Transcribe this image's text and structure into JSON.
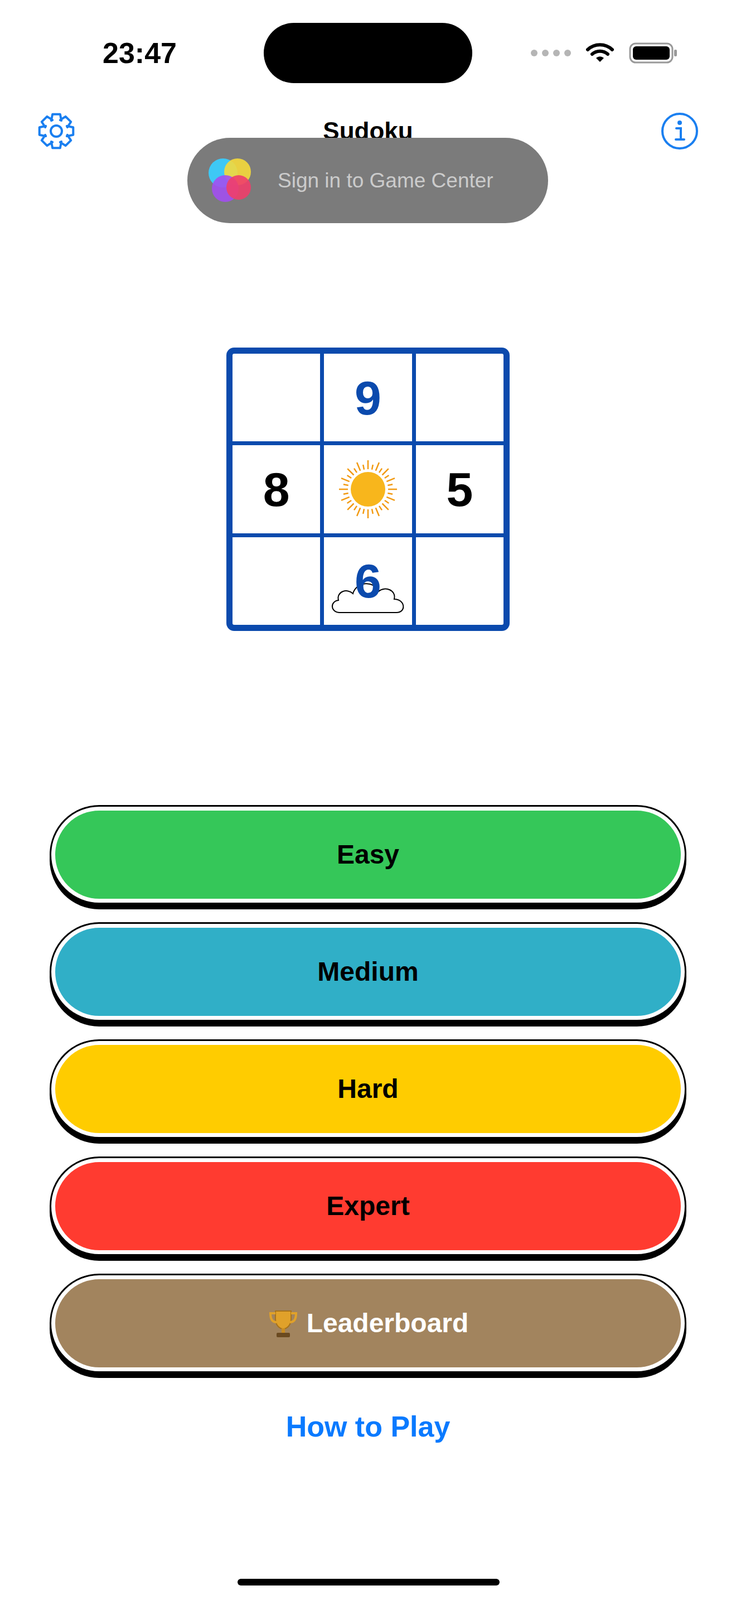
{
  "status_bar": {
    "time": "23:47"
  },
  "nav": {
    "title": "Sudoku"
  },
  "banner": {
    "text": "Sign in to Game Center"
  },
  "logo": {
    "cells": [
      {
        "text": "",
        "kind": "blank"
      },
      {
        "text": "9",
        "kind": "entry"
      },
      {
        "text": "",
        "kind": "blank"
      },
      {
        "text": "8",
        "kind": "given"
      },
      {
        "text": "",
        "kind": "sun"
      },
      {
        "text": "5",
        "kind": "given"
      },
      {
        "text": "",
        "kind": "blank"
      },
      {
        "text": "6",
        "kind": "cloud"
      },
      {
        "text": "",
        "kind": "blank"
      }
    ]
  },
  "buttons": [
    {
      "label": "Easy",
      "kind": "difficulty",
      "color": "#35c759"
    },
    {
      "label": "Medium",
      "kind": "difficulty",
      "color": "#30afc7"
    },
    {
      "label": "Hard",
      "kind": "difficulty",
      "color": "#ffcc00"
    },
    {
      "label": "Expert",
      "kind": "difficulty",
      "color": "#ff3b30"
    },
    {
      "label": "Leaderboard",
      "kind": "leaderboard",
      "color": "#a2845e"
    }
  ],
  "link": {
    "text": "How to Play"
  }
}
